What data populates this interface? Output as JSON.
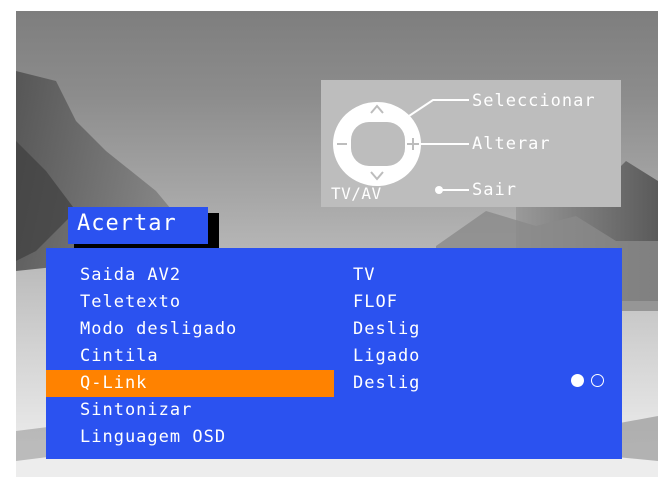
{
  "help": {
    "select": "Seleccionar",
    "change": "Alterar",
    "exit": "Sair",
    "tv_av": "TV/AV"
  },
  "menu": {
    "title": "Acertar",
    "selected_index": 4,
    "items": [
      {
        "label": "Saida AV2",
        "value": "TV"
      },
      {
        "label": "Teletexto",
        "value": "FLOF"
      },
      {
        "label": "Modo desligado",
        "value": "Deslig"
      },
      {
        "label": "Cintila",
        "value": "Ligado"
      },
      {
        "label": "Q-Link",
        "value": "Deslig"
      },
      {
        "label": "Sintonizar",
        "value": ""
      },
      {
        "label": "Linguagem OSD",
        "value": ""
      }
    ]
  },
  "colors": {
    "menu_bg": "#2b52f0",
    "highlight": "#ff8200",
    "help_bg": "#bdbdbd",
    "text": "#ffffff"
  },
  "icons": [
    "remote-cursor-pad-icon",
    "page-indicator-dots-icon"
  ]
}
